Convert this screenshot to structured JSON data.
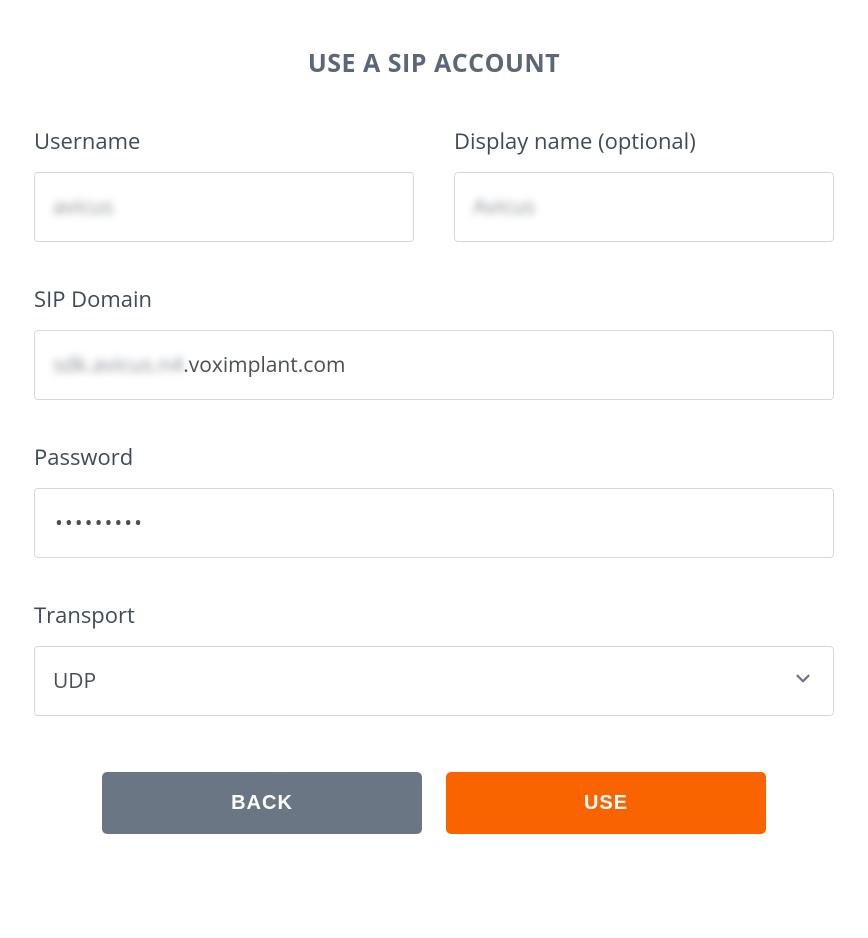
{
  "title": "USE A SIP ACCOUNT",
  "fields": {
    "username": {
      "label": "Username",
      "value_obscured": "avicus"
    },
    "display_name": {
      "label": "Display name (optional)",
      "value_obscured": "Avicus"
    },
    "sip_domain": {
      "label": "SIP Domain",
      "prefix_obscured": "sdk.avicus.n4",
      "suffix": ".voximplant.com"
    },
    "password": {
      "label": "Password",
      "value": "•••••••••"
    },
    "transport": {
      "label": "Transport",
      "value": "UDP"
    }
  },
  "buttons": {
    "back": "BACK",
    "use": "USE"
  }
}
